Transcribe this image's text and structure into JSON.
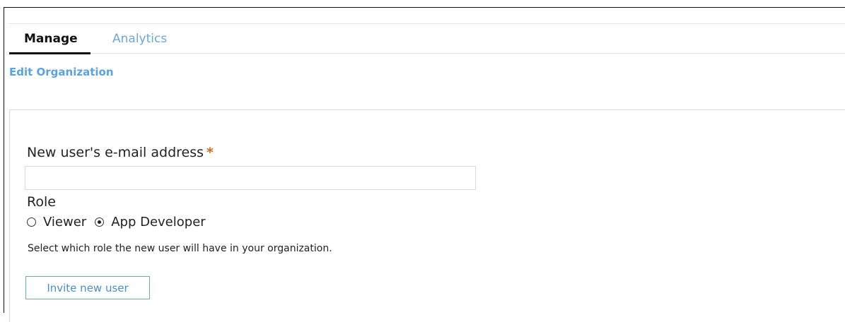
{
  "tabs": [
    {
      "label": "Manage",
      "active": true
    },
    {
      "label": "Analytics",
      "active": false
    }
  ],
  "edit_link": "Edit Organization",
  "form": {
    "email_label": "New user's e-mail address",
    "required_mark": "*",
    "email_value": "",
    "role_label": "Role",
    "roles": [
      {
        "label": "Viewer",
        "checked": false
      },
      {
        "label": "App Developer",
        "checked": true
      }
    ],
    "help_text": "Select which role the new user will have in your organization.",
    "submit_label": "Invite new user"
  },
  "colors": {
    "link": "#5aa2e0",
    "required": "#d2691e",
    "button_border": "#6aa8dc"
  }
}
